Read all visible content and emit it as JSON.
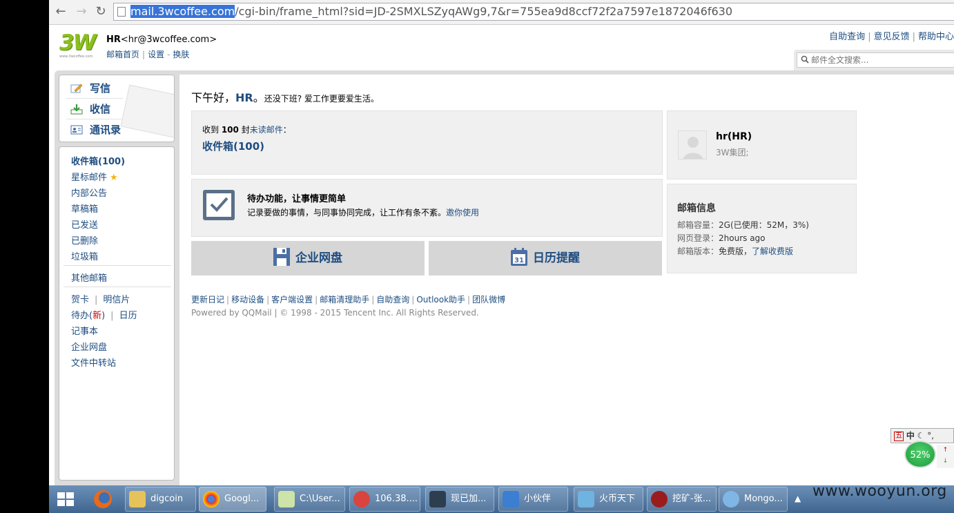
{
  "browser": {
    "url_host": "mail.3wcoffee.com",
    "url_path": "/cgi-bin/frame_html?sid=JD-2SMXLSZyqAWg9,7&r=755ea9d8ccf72f2a7597e1872046f630"
  },
  "header": {
    "logo_text": "3W",
    "logo_small": "www.3wcoffee.com",
    "user_name": "HR",
    "user_email": "<hr@3wcoffee.com>",
    "links": [
      "邮箱首页",
      "设置",
      "换肤"
    ],
    "top_links": [
      "自助查询",
      "意见反馈",
      "帮助中心"
    ],
    "search_placeholder": "邮件全文搜索..."
  },
  "quick_actions": [
    {
      "label": "写信",
      "icon": "write-icon"
    },
    {
      "label": "收信",
      "icon": "receive-icon"
    },
    {
      "label": "通讯录",
      "icon": "contacts-icon"
    }
  ],
  "folders": {
    "inbox": "收件箱(100)",
    "starred": "星标邮件",
    "notice": "内部公告",
    "drafts": "草稿箱",
    "sent": "已发送",
    "deleted": "已删除",
    "spam": "垃圾箱",
    "other": "其他邮箱",
    "card": "贺卡",
    "postcard": "明信片",
    "todo": "待办(",
    "todo_new": "新",
    "todo_close": ")",
    "calendar": "日历",
    "notes": "记事本",
    "disk": "企业网盘",
    "transfer": "文件中转站"
  },
  "greeting": {
    "prefix": "下午好，",
    "name": "HR",
    "suffix": "。",
    "sub": "还没下班? 爱工作更要爱生活。"
  },
  "unread": {
    "line_prefix": "收到 ",
    "count": "100",
    "line_mid": " 封",
    "line_link": "未读邮件",
    "line_suffix": "：",
    "inbox_link": "收件箱(100)"
  },
  "todo_card": {
    "title": "待办功能，让事情更简单",
    "desc": "记录要做的事情，与同事协同完成，让工作有条不紊。",
    "link": "邀你使用"
  },
  "buttons": {
    "disk": "企业网盘",
    "calendar": "日历提醒",
    "calendar_day": "31"
  },
  "profile": {
    "name": "hr(HR)",
    "org": "3W集团;"
  },
  "mail_info": {
    "title": "邮箱信息",
    "capacity_label": "邮箱容量：",
    "capacity_value": "2G(已使用：52M，3%)",
    "login_label": "网页登录：",
    "login_value": "2hours ago",
    "version_label": "邮箱版本：",
    "version_value": "免费版，",
    "version_link": "了解收费版"
  },
  "footer": {
    "links": [
      "更新日记",
      "移动设备",
      "客户端设置",
      "邮箱清理助手",
      "自助查询",
      "Outlook助手",
      "团队微博"
    ],
    "copyright": "Powered by QQMail  | © 1998 - 2015 Tencent Inc. All Rights Reserved."
  },
  "ime": {
    "box": "五",
    "mode": "中"
  },
  "speed_ball": "52%",
  "taskbar": {
    "items": [
      "digcoin",
      "Googl...",
      "C:\\User...",
      "106.38....",
      "现已加...",
      "小伙伴",
      "火币天下",
      "挖矿-张...",
      "Mongo..."
    ]
  },
  "watermark": "www.wooyun.org"
}
